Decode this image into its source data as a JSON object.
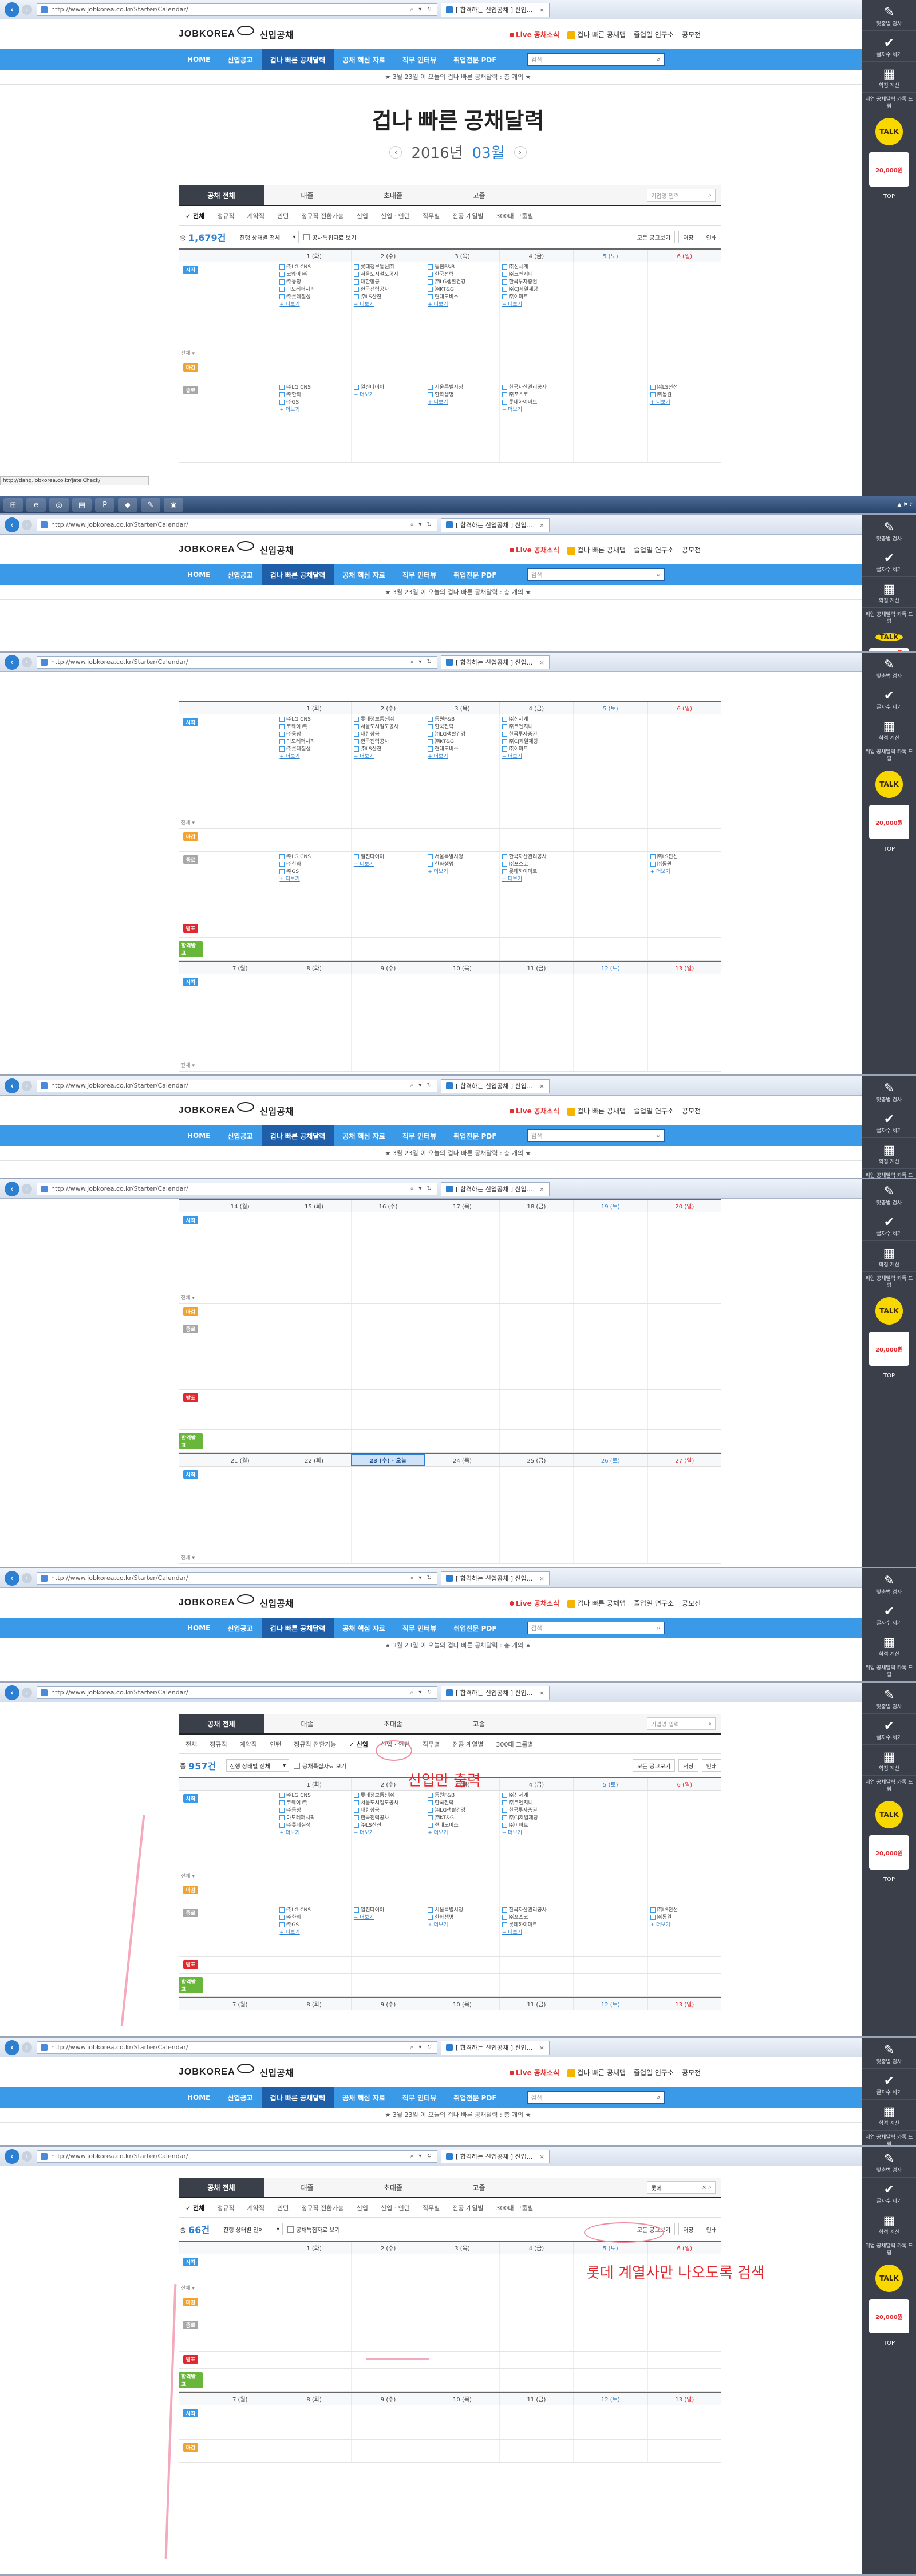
{
  "browser": {
    "url": "http://www.jobkorea.co.kr/Starter/Calendar/",
    "tab_title": "[ 합격하는 신입공채 ] 신입...",
    "status_url": "http://tiang.jobkorea.co.kr/jatelCheck/"
  },
  "header": {
    "logo": "JOBKOREA",
    "service": "신입공채",
    "links": [
      "Live 공채소식",
      "겁나 빠른 공채맵",
      "졸업일 연구소",
      "공모전"
    ]
  },
  "gnb": {
    "items": [
      "HOME",
      "신입공고",
      "겁나 빠른 공채달력",
      "공채 핵심 자료",
      "직무 인터뷰",
      "취업전문 PDF"
    ],
    "search_placeholder": "검색"
  },
  "notice": "★ 3월 23일 이 오늘의 겁나 빠른 공채달력 : 총 개의 ★",
  "hero": {
    "title": "겁나 빠른 공채달력",
    "year": "2016년",
    "month": "03월"
  },
  "filter": {
    "tabs": [
      "공채 전체",
      "대졸",
      "초대졸",
      "고졸"
    ],
    "search_placeholder": "기업명 입력",
    "search_value_final": "롯데",
    "types": [
      "전체",
      "정규직",
      "계약직",
      "인턴",
      "정규직 전환가능",
      "신입",
      "신입 · 인턴",
      "직무별",
      "전공 계열별",
      "300대 그룹별"
    ],
    "status_select": "진행 상태별 전체",
    "bookmark_check": "공채특집자료 보기",
    "buttons": [
      "모든 공고보기",
      "저장",
      "인쇄"
    ],
    "count_all": "1,679건",
    "count_newonly": "957건",
    "count_lotte": "66건"
  },
  "quick_menu": {
    "items": [
      "맞춤법 검사",
      "글자수 세기",
      "학점 계산"
    ],
    "promo_text": "취업 공채달력 카톡 드림",
    "talk": "TALK",
    "reward": "20,000원",
    "top": "TOP"
  },
  "legend": {
    "start": "시작",
    "end": "마감",
    "deadline": "종료",
    "announce": "발표",
    "pass": "합격발표"
  },
  "weeks": {
    "w1_days": [
      "1 (화)",
      "2 (수)",
      "3 (목)",
      "4 (금)",
      "5 (토)",
      "6 (일)"
    ],
    "w2_days": [
      "7 (월)",
      "8 (화)",
      "9 (수)",
      "10 (목)",
      "11 (금)",
      "12 (토)",
      "13 (일)"
    ],
    "w3_days": [
      "14 (월)",
      "15 (화)",
      "16 (수)",
      "17 (목)",
      "18 (금)",
      "19 (토)",
      "20 (일)"
    ],
    "w4_days": [
      "21 (월)",
      "22 (화)",
      "23 (수) · 오늘",
      "24 (목)",
      "25 (금)",
      "26 (토)",
      "27 (일)"
    ],
    "more": "+ 더보기",
    "view": "전체 ▾"
  },
  "annotations": {
    "new_only": "신입만 출력",
    "lotte_search": "롯데 계열사만 나오도록 검색"
  },
  "companies": {
    "w1_start": [
      [
        "㈜LG CNS",
        "코웨이 ㈜",
        "㈜동양",
        "아모레퍼시픽",
        "㈜롯데칠성"
      ],
      [
        "롯데정보통신㈜",
        "서울도시철도공사",
        "대한항공",
        "한국전력공사",
        "㈜LS산전"
      ],
      [
        "동원F&B",
        "한국전력",
        "㈜LG생활건강",
        "㈜KT&G",
        "현대모비스"
      ],
      [
        "㈜신세계",
        "㈜코엔지니",
        "한국투자증권",
        "㈜CJ제일제당",
        "㈜이마트"
      ],
      [],
      []
    ],
    "w1_dead": [
      [
        "㈜LG CNS",
        "㈜한화",
        "㈜GS"
      ],
      [
        "일진다이아"
      ],
      [
        "서울특별시청",
        "한화생명"
      ],
      [
        "한국자산관리공사",
        "㈜포스코",
        "롯데하이마트"
      ],
      [],
      [
        "㈜LS전선",
        "㈜동원"
      ]
    ]
  }
}
